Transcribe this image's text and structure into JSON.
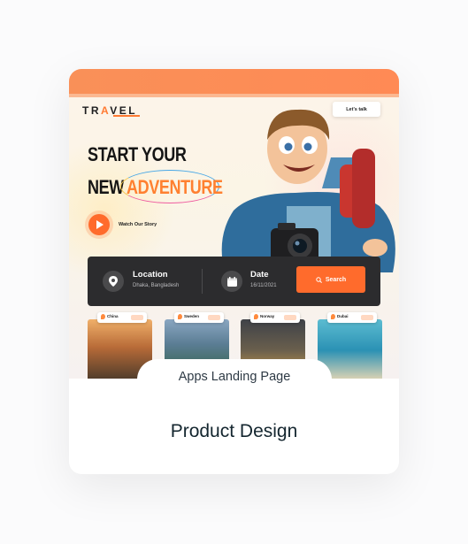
{
  "brand": {
    "logo_prefix": "TR",
    "logo_accent": "A",
    "logo_suffix": "VEL"
  },
  "header": {
    "cta": "Let's talk"
  },
  "hero": {
    "line1": "START YOUR",
    "line2_prefix": "NEW",
    "line2_highlight": "ADVENTURE",
    "watch_label": "Watch Our Story"
  },
  "search_bar": {
    "location_label": "Location",
    "location_value": "Dhaka, Bangladesh",
    "date_label": "Date",
    "date_value": "16/11/2021",
    "button_label": "Search"
  },
  "destinations": [
    {
      "name": "China"
    },
    {
      "name": "Sweden"
    },
    {
      "name": "Norway"
    },
    {
      "name": "Dubai"
    }
  ],
  "card": {
    "badge": "Apps Landing Page",
    "title": "Product Design"
  },
  "colors": {
    "accent": "#ff6b2c",
    "topbar": "#f99058",
    "dark_bar": "#2c2c2e",
    "title": "#14262f"
  }
}
